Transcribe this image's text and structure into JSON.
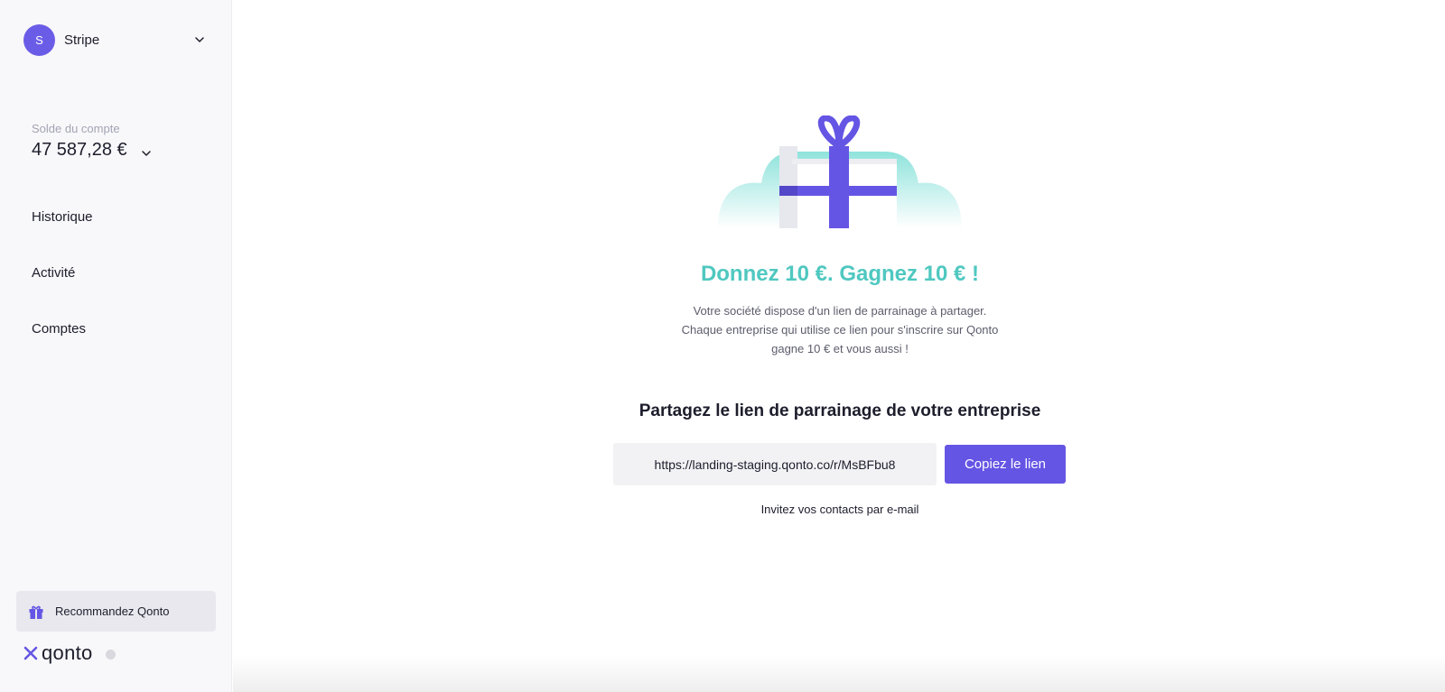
{
  "sidebar": {
    "org": {
      "initial": "S",
      "name": "Stripe"
    },
    "balance": {
      "label": "Solde du compte",
      "value": "47 587,28 €"
    },
    "nav": [
      {
        "label": "Historique"
      },
      {
        "label": "Activité"
      },
      {
        "label": "Comptes"
      }
    ],
    "recommend_label": "Recommandez Qonto",
    "brand": "qonto"
  },
  "main": {
    "headline": "Donnez 10 €. Gagnez 10 € !",
    "description": "Votre société dispose d'un lien de parrainage à partager. Chaque entreprise qui utilise ce lien pour s'inscrire sur Qonto gagne 10 € et vous aussi !",
    "share_title": "Partagez le lien de parrainage de votre entreprise",
    "referral_link": "https://landing-staging.qonto.co/r/MsBFbu8",
    "copy_label": "Copiez le lien",
    "invite_label": "Invitez vos contacts par e-mail"
  },
  "colors": {
    "accent": "#6555e4",
    "headline": "#4fc8c0",
    "avatar": "#6b5ce7",
    "sidebar_bg": "#f8f8fa"
  },
  "icons": [
    "chevron-down-icon",
    "gift-icon",
    "qonto-logo-icon",
    "gift-illustration"
  ]
}
